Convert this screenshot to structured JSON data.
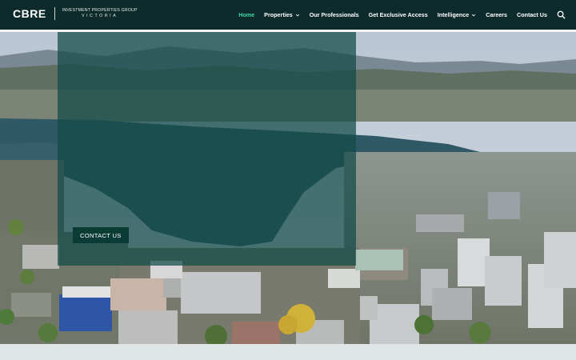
{
  "brand": {
    "name": "CBRE",
    "tagline_line1": "INVESTMENT PROPERTIES GROUP",
    "tagline_line2": "VICTORIA"
  },
  "nav": {
    "items": [
      {
        "label": "Home",
        "active": true,
        "dropdown": false
      },
      {
        "label": "Properties",
        "active": false,
        "dropdown": true
      },
      {
        "label": "Our Professionals",
        "active": false,
        "dropdown": false
      },
      {
        "label": "Get Exclusive Access",
        "active": false,
        "dropdown": false
      },
      {
        "label": "Intelligence",
        "active": false,
        "dropdown": true
      },
      {
        "label": "Careers",
        "active": false,
        "dropdown": false
      },
      {
        "label": "Contact Us",
        "active": false,
        "dropdown": false
      }
    ],
    "search_icon": "search-icon"
  },
  "hero": {
    "cta_label": "CONTACT US",
    "image": "aerial-city-harbour-photo"
  },
  "colors": {
    "header_bg": "#0d2b2a",
    "nav_active": "#3dd7a4",
    "overlay": "#124a46",
    "button_bg": "#0b3b35"
  }
}
